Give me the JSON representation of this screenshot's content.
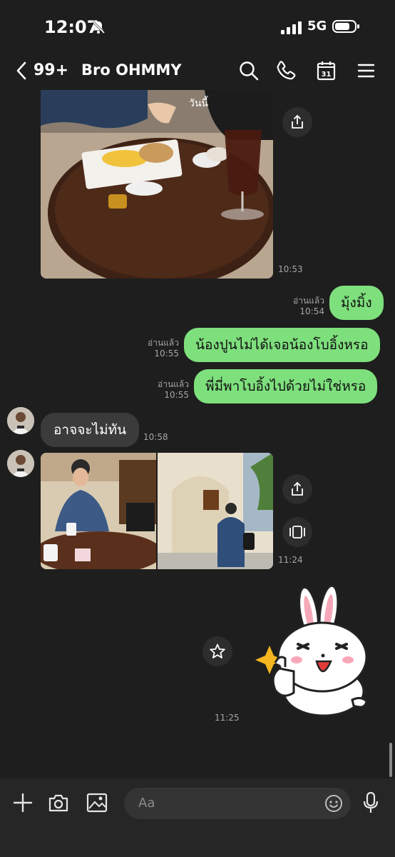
{
  "status_bar": {
    "time": "12:07",
    "network": "5G",
    "battery_level": 0.75
  },
  "header": {
    "unread_count": "99+",
    "title": "Bro OHMMY"
  },
  "messages": {
    "photo1": {
      "time": "10:53",
      "caption": "วันนี้"
    },
    "out1": {
      "read": "อ่านแล้ว",
      "time": "10:54",
      "text": "มุ้งมิ้ง"
    },
    "out2": {
      "read": "อ่านแล้ว",
      "time": "10:55",
      "text": "น้องปูนไม่ได้เจอน้องโบอิ้งหรอ"
    },
    "out3": {
      "read": "อ่านแล้ว",
      "time": "10:55",
      "text": "พี่มี่พาโบอิ้งไปด้วยไม่ใช่หรอ"
    },
    "in1": {
      "time": "10:58",
      "text": "อาจจะไม่ทัน"
    },
    "photos2": {
      "time": "11:24"
    },
    "sticker": {
      "time": "11:25"
    }
  },
  "input": {
    "placeholder": "Aa"
  },
  "icons": {
    "search": "search-icon",
    "call": "phone-icon",
    "calendar": "calendar-icon",
    "menu": "menu-icon",
    "share": "share-icon",
    "album": "album-icon",
    "star": "star-icon",
    "plus": "plus-icon",
    "camera": "camera-icon",
    "gallery": "image-icon",
    "emoji": "emoji-icon",
    "mic": "mic-icon"
  },
  "colors": {
    "outgoing_bubble": "#7ee07d",
    "incoming_bubble": "#3b3b3b",
    "background": "#1e1e1e"
  }
}
